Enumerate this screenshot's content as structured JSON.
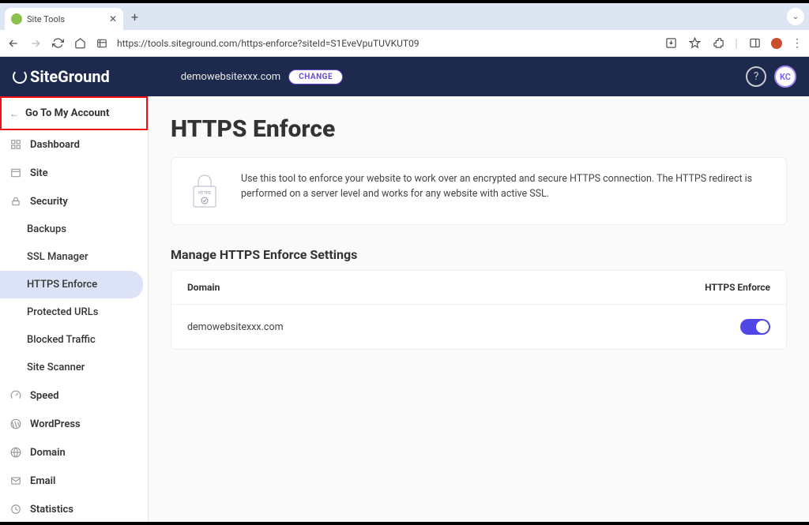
{
  "browser": {
    "tab_title": "Site Tools",
    "url": "https://tools.siteground.com/https-enforce?siteId=S1EveVpuTUVKUT09"
  },
  "header": {
    "logo_text": "SiteGround",
    "domain": "demowebsitexxx.com",
    "change_label": "CHANGE",
    "avatar_initials": "KC"
  },
  "sidebar": {
    "goto_label": "Go To My Account",
    "items": [
      {
        "label": "Dashboard"
      },
      {
        "label": "Site"
      },
      {
        "label": "Security"
      },
      {
        "label": "Backups",
        "sub": true
      },
      {
        "label": "SSL Manager",
        "sub": true
      },
      {
        "label": "HTTPS Enforce",
        "sub": true,
        "active": true
      },
      {
        "label": "Protected URLs",
        "sub": true
      },
      {
        "label": "Blocked Traffic",
        "sub": true
      },
      {
        "label": "Site Scanner",
        "sub": true
      },
      {
        "label": "Speed"
      },
      {
        "label": "WordPress"
      },
      {
        "label": "Domain"
      },
      {
        "label": "Email"
      },
      {
        "label": "Statistics"
      }
    ]
  },
  "page": {
    "title": "HTTPS Enforce",
    "info_text": "Use this tool to enforce your website to work over an encrypted and secure HTTPS connection. The HTTPS redirect is performed on a server level and works for any website with active SSL.",
    "lock_label": "HTTPS",
    "section_title": "Manage HTTPS Enforce Settings",
    "table": {
      "col_domain": "Domain",
      "col_enforce": "HTTPS Enforce",
      "rows": [
        {
          "domain": "demowebsitexxx.com",
          "enforce": true
        }
      ]
    }
  }
}
